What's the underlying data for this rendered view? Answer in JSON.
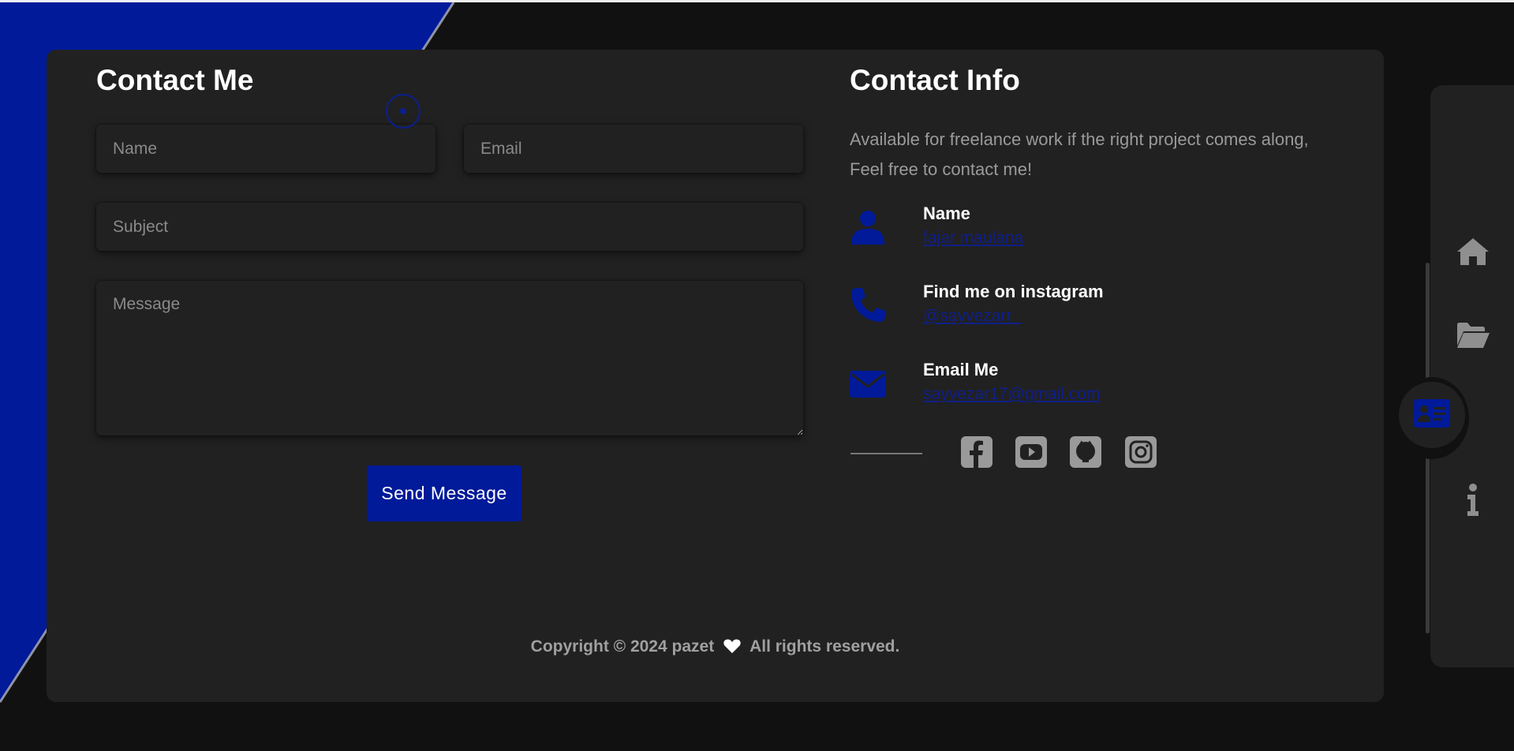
{
  "form": {
    "title": "Contact Me",
    "name_placeholder": "Name",
    "email_placeholder": "Email",
    "subject_placeholder": "Subject",
    "message_placeholder": "Message",
    "send_label": "Send Message"
  },
  "info": {
    "title": "Contact Info",
    "description": "Available for freelance work if the right project comes along, Feel free to contact me!",
    "items": [
      {
        "icon": "user-icon",
        "label": "Name",
        "value": "fajar maulana"
      },
      {
        "icon": "phone-icon",
        "label": "Find me on instagram",
        "value": "@sayvezarr_"
      },
      {
        "icon": "envelope-icon",
        "label": "Email Me",
        "value": "sayvezar17@gmail.com"
      }
    ],
    "socials": [
      "facebook-icon",
      "youtube-icon",
      "github-icon",
      "instagram-icon"
    ]
  },
  "footer": {
    "before": "Copyright © 2024 pazet",
    "after": "All rights reserved."
  },
  "nav": {
    "items": [
      "home-icon",
      "folder-icon",
      "contact-card-icon",
      "info-icon"
    ],
    "active": "contact-card-icon"
  },
  "colors": {
    "accent": "#001a99",
    "link": "#0f1f8a",
    "card": "#212121",
    "background": "#111111"
  }
}
